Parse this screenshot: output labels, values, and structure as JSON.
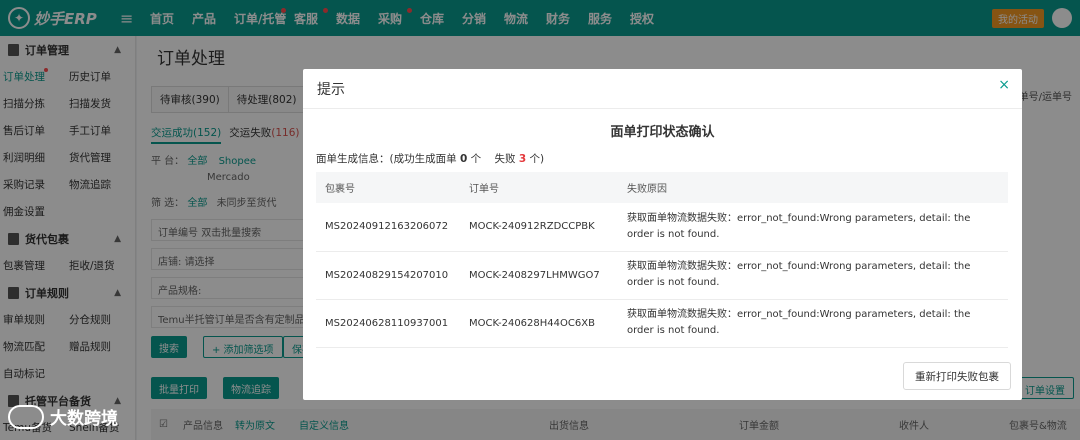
{
  "app": {
    "logo_text": "妙手ERP",
    "promo": "我的活动"
  },
  "nav": [
    {
      "label": "首页",
      "dot": false
    },
    {
      "label": "产品",
      "dot": false
    },
    {
      "label": "订单/托管",
      "dot": true
    },
    {
      "label": "客服",
      "dot": true
    },
    {
      "label": "数据",
      "dot": false
    },
    {
      "label": "采购",
      "dot": true
    },
    {
      "label": "仓库",
      "dot": false
    },
    {
      "label": "分销",
      "dot": false
    },
    {
      "label": "物流",
      "dot": false
    },
    {
      "label": "财务",
      "dot": false
    },
    {
      "label": "服务",
      "dot": false
    },
    {
      "label": "授权",
      "dot": false
    }
  ],
  "sidebar": {
    "group1": "订单管理",
    "rows1": [
      [
        "订单处理",
        "历史订单"
      ],
      [
        "扫描分拣",
        "扫描发货"
      ],
      [
        "售后订单",
        "手工订单"
      ],
      [
        "利润明细",
        "货代管理"
      ],
      [
        "采购记录",
        "物流追踪"
      ],
      [
        "佣金设置",
        ""
      ]
    ],
    "group2": "货代包裹",
    "rows2": [
      [
        "包裹管理",
        "拒收/退货"
      ]
    ],
    "group3": "订单规则",
    "rows3": [
      [
        "审单规则",
        "分仓规则"
      ],
      [
        "物流匹配",
        "赠品规则"
      ],
      [
        "自动标记",
        ""
      ]
    ],
    "group4": "托管平台备货",
    "rows4": [
      [
        "Temu备货",
        "Shein备货"
      ]
    ]
  },
  "page": {
    "title": "订单处理",
    "tab1": "待审核(390)",
    "tab2": "待处理(802)",
    "subtab_ok": "交运成功(152)",
    "subtab_fail_label": "交运失败",
    "subtab_fail_count": "(116)",
    "platform_label": "平 台：",
    "platform_all": "全部",
    "platform_shopee": "Shopee",
    "platform_mercado": "Mercado",
    "filter_label": "筛 选：",
    "filter_all": "全部",
    "filter_unsync": "未同步至货代",
    "order_no_label": "订单编号",
    "order_no_hint": "双击批量搜索",
    "shop_label": "店铺:",
    "shop_hint": "请选择",
    "spec_label": "产品规格:",
    "temu_label": "Temu半托管订单是否含有定制品:",
    "search_btn": "搜索",
    "add_filter_btn": "+ 添加筛选项",
    "save_btn": "保存",
    "batch_btn": "批量打印",
    "track_btn": "物流追踪",
    "search_right": "订单号/运单号",
    "order_settings": "订单设置",
    "col_product": "产品信息",
    "col_translate": "转为原文",
    "col_custom": "自定义信息",
    "col_ship": "出货信息",
    "col_amount": "订单金额",
    "col_receiver": "收件人",
    "col_pkg": "包裹号&物流"
  },
  "modal": {
    "title": "提示",
    "close": "×",
    "heading": "面单打印状态确认",
    "summary_prefix": "面单生成信息：(成功生成面单",
    "success_count": "0",
    "summary_mid": "个    失败",
    "fail_count": "3",
    "summary_suffix": "个)",
    "headers": [
      "包裹号",
      "订单号",
      "失败原因"
    ],
    "rows": [
      {
        "pkg": "MS20240912163206072",
        "order": "MOCK-240912RZDCCPBK",
        "reason": "获取面单物流数据失败：error_not_found:Wrong parameters, detail: the order is not found."
      },
      {
        "pkg": "MS20240829154207010",
        "order": "MOCK-2408297LHMWGO7",
        "reason": "获取面单物流数据失败：error_not_found:Wrong parameters, detail: the order is not found."
      },
      {
        "pkg": "MS20240628110937001",
        "order": "MOCK-240628H44OC6XB",
        "reason": "获取面单物流数据失败：error_not_found:Wrong parameters, detail: the order is not found."
      }
    ],
    "reprint_btn": "重新打印失败包裹"
  },
  "watermark": "大数跨境",
  "colors": {
    "brand": "#0a9c8f",
    "danger": "#e4393c",
    "promo": "#f59a23"
  }
}
